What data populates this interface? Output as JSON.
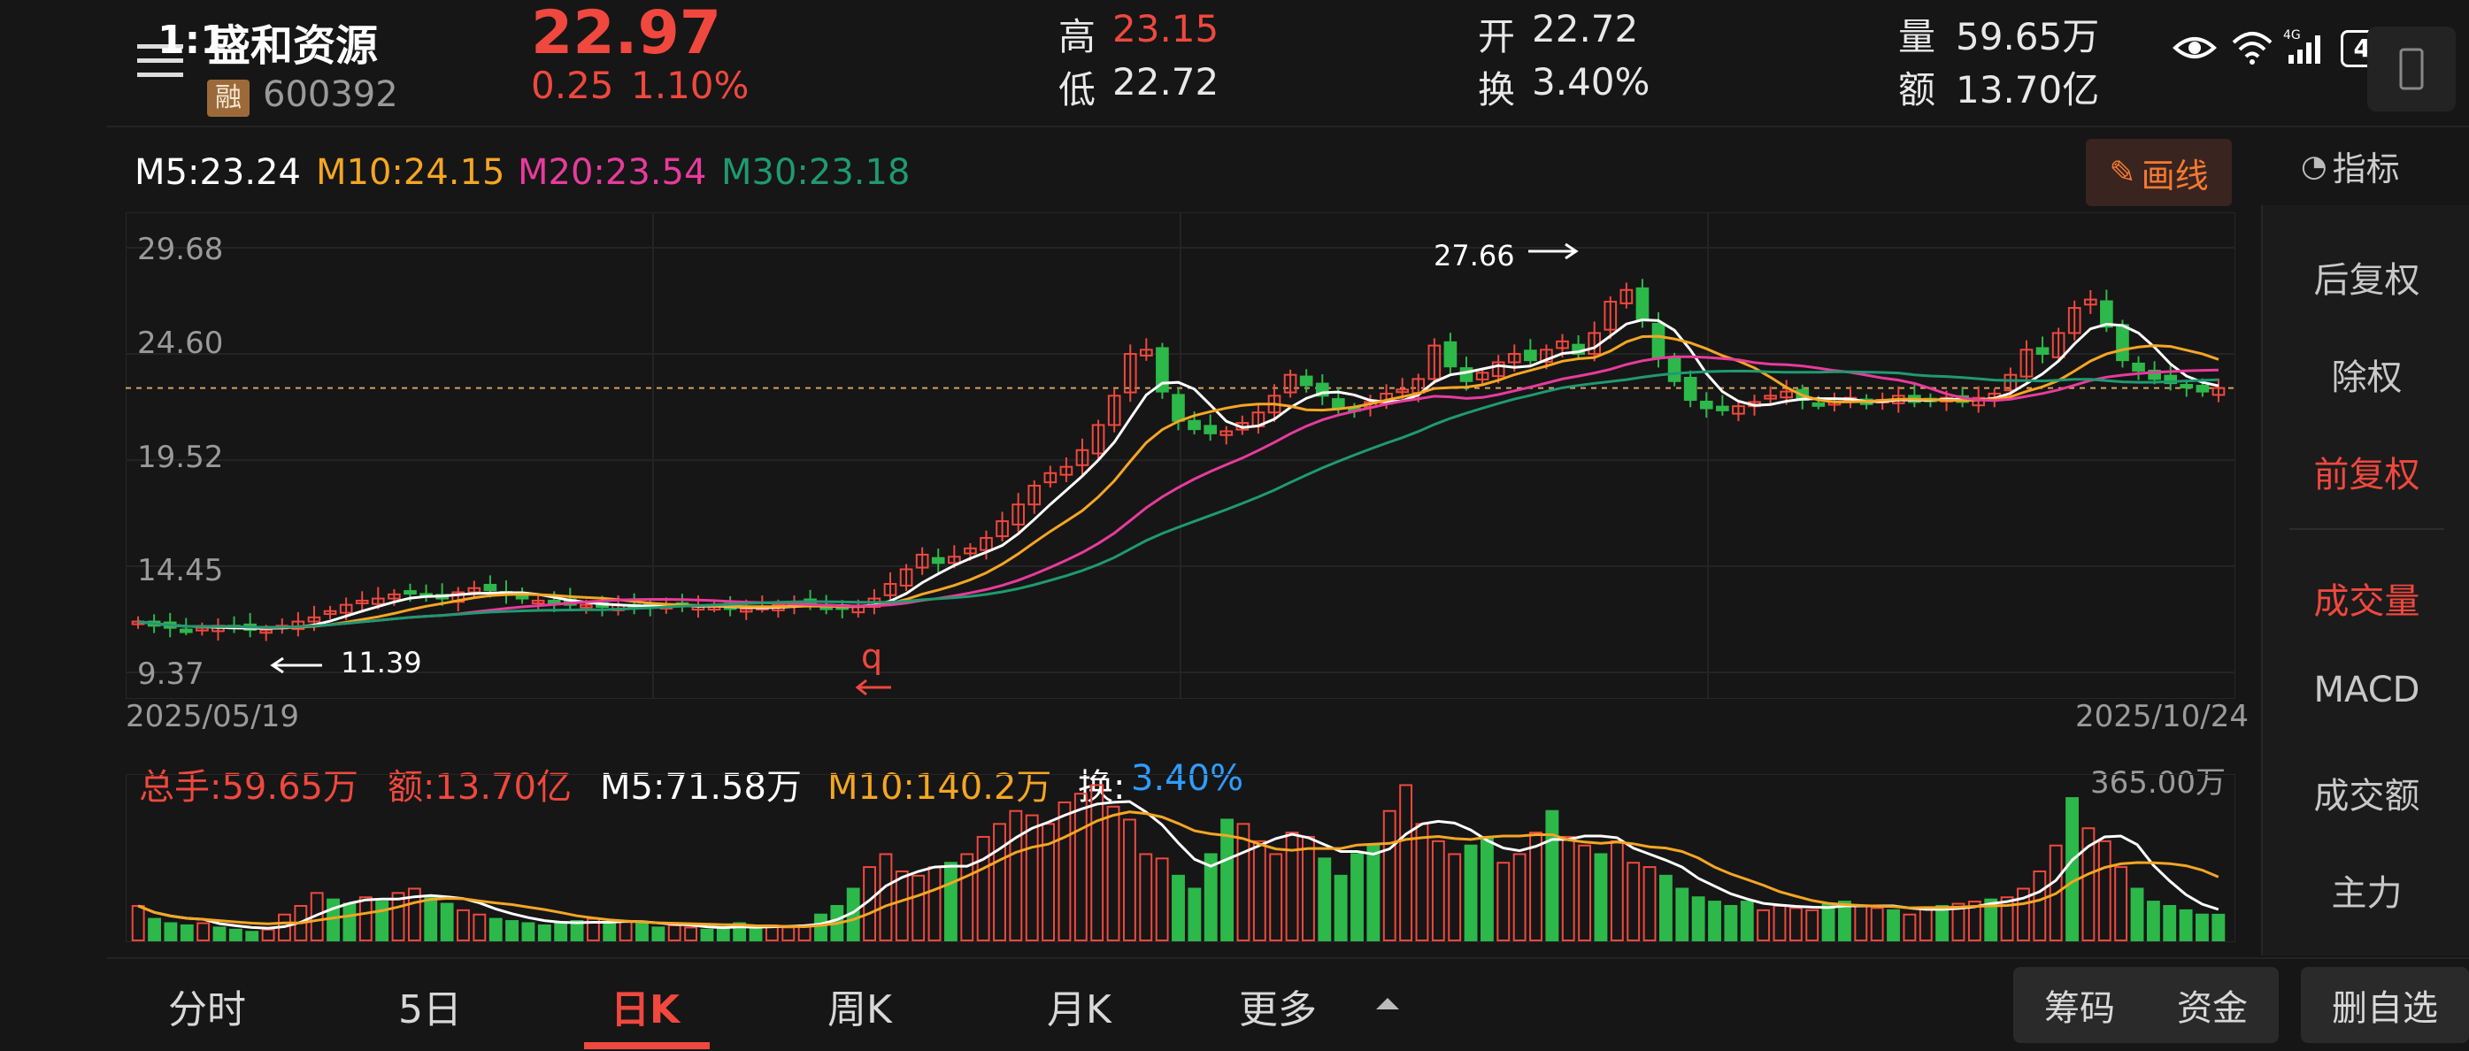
{
  "header": {
    "menu_overlay": "1:1",
    "stock_name": "盛和资源",
    "margin_badge": "融",
    "stock_code": "600392",
    "price": "22.97",
    "change": "0.25",
    "change_pct": "1.10%",
    "high_label": "高",
    "high_value": "23.15",
    "low_label": "低",
    "low_value": "22.72",
    "open_label": "开",
    "open_value": "22.72",
    "turnover_label": "换",
    "turnover_value": "3.40%",
    "volume_label": "量",
    "volume_value": "59.65万",
    "amount_label": "额",
    "amount_value": "13.70亿",
    "battery": "47"
  },
  "ma_legend": {
    "m5": "M5:23.24",
    "m10": "M10:24.15",
    "m20": "M20:23.54",
    "m30": "M30:23.18"
  },
  "draw_button": "画线",
  "indicator_button": "指标",
  "price_axis": [
    "29.68",
    "24.60",
    "19.52",
    "14.45",
    "9.37"
  ],
  "date_start": "2025/05/19",
  "date_end": "2025/10/24",
  "annotations": {
    "high_mark": "27.66",
    "low_mark": "11.39",
    "q_mark": "q"
  },
  "volume_legend": {
    "total": "总手:59.65万",
    "amount": "额:13.70亿",
    "m5": "M5:71.58万",
    "m10": "M10:140.2万",
    "turnover_label": "换:",
    "turnover_value": "3.40%",
    "vol_max": "365.00万"
  },
  "sidebar": {
    "items": [
      "后复权",
      "除权",
      "前复权",
      "成交量",
      "MACD",
      "成交额",
      "主力"
    ]
  },
  "tabs": [
    "分时",
    "5日",
    "日K",
    "周K",
    "月K",
    "更多"
  ],
  "bottom_buttons": [
    "筹码",
    "资金",
    "删自选"
  ],
  "colors": {
    "up": "#f0483e",
    "down": "#2db84a",
    "m5": "#ffffff",
    "m10": "#f5a623",
    "m20": "#e83b9d",
    "m30": "#1f9a70",
    "background": "#161616"
  },
  "chart_data": {
    "type": "candlestick",
    "x_range": [
      "2025/05/19",
      "2025/10/24"
    ],
    "ylim": [
      9.37,
      29.68
    ],
    "y_ticks": [
      29.68,
      24.6,
      19.52,
      14.45,
      9.37
    ],
    "current_price": 22.97,
    "high": 27.66,
    "low": 11.39,
    "closes": [
      11.8,
      11.6,
      11.5,
      11.4,
      11.5,
      11.6,
      11.5,
      11.4,
      11.39,
      11.6,
      11.8,
      12.0,
      12.3,
      12.6,
      12.8,
      12.9,
      13.1,
      13.2,
      13.0,
      12.9,
      13.2,
      13.4,
      13.3,
      13.1,
      12.9,
      12.8,
      12.7,
      12.6,
      12.6,
      12.5,
      12.6,
      12.5,
      12.5,
      12.6,
      12.6,
      12.5,
      12.5,
      12.4,
      12.4,
      12.5,
      12.6,
      12.7,
      12.6,
      12.5,
      12.4,
      12.5,
      12.9,
      13.6,
      14.3,
      15.0,
      14.6,
      14.9,
      15.3,
      15.8,
      16.6,
      17.4,
      18.3,
      18.9,
      19.2,
      20.0,
      21.2,
      22.6,
      24.6,
      24.8,
      22.8,
      21.4,
      21.0,
      20.8,
      20.9,
      21.3,
      21.8,
      22.6,
      23.6,
      23.1,
      22.6,
      22.0,
      21.9,
      22.3,
      22.7,
      22.9,
      23.4,
      25.0,
      24.0,
      23.3,
      23.7,
      24.2,
      24.6,
      24.3,
      24.8,
      25.2,
      24.6,
      25.6,
      27.1,
      27.66,
      26.2,
      24.4,
      23.3,
      22.4,
      22.0,
      21.9,
      22.1,
      22.3,
      22.6,
      22.8,
      22.4,
      22.2,
      22.3,
      22.5,
      22.2,
      22.4,
      22.6,
      22.3,
      22.4,
      22.5,
      22.3,
      22.5,
      22.7,
      23.6,
      24.8,
      24.6,
      25.6,
      26.8,
      27.2,
      25.9,
      24.3,
      23.8,
      23.4,
      23.2,
      23.0,
      22.8,
      22.97
    ],
    "ma_values": {
      "M5": 23.24,
      "M10": 24.15,
      "M20": 23.54,
      "M30": 23.18
    },
    "volume": {
      "unit": "万",
      "max": 365.0,
      "total": 59.65,
      "m5": 71.58,
      "m10": 140.2,
      "values": [
        80,
        50,
        40,
        35,
        40,
        30,
        25,
        20,
        25,
        60,
        80,
        110,
        95,
        85,
        100,
        90,
        110,
        120,
        100,
        85,
        70,
        60,
        50,
        45,
        40,
        35,
        40,
        45,
        50,
        40,
        45,
        38,
        30,
        35,
        30,
        25,
        28,
        40,
        30,
        35,
        30,
        35,
        60,
        80,
        120,
        170,
        200,
        160,
        150,
        170,
        180,
        200,
        240,
        270,
        300,
        290,
        270,
        320,
        340,
        360,
        310,
        280,
        200,
        190,
        150,
        120,
        200,
        280,
        270,
        230,
        200,
        250,
        240,
        190,
        150,
        200,
        220,
        300,
        360,
        270,
        230,
        200,
        220,
        240,
        180,
        200,
        250,
        300,
        240,
        220,
        200,
        230,
        180,
        170,
        150,
        120,
        100,
        90,
        80,
        90,
        70,
        80,
        75,
        70,
        85,
        90,
        80,
        75,
        70,
        60,
        75,
        80,
        85,
        90,
        95,
        100,
        120,
        160,
        220,
        330,
        260,
        230,
        170,
        120,
        90,
        80,
        70,
        60,
        59.65
      ],
      "up": [
        true,
        false,
        false,
        false,
        true,
        false,
        false,
        false,
        true,
        true,
        true,
        true,
        false,
        false,
        true,
        false,
        true,
        true,
        false,
        false,
        true,
        true,
        false,
        false,
        false,
        false,
        false,
        false,
        true,
        false,
        true,
        false,
        false,
        true,
        true,
        false,
        false,
        false,
        false,
        true,
        true,
        true,
        false,
        false,
        false,
        true,
        true,
        true,
        true,
        true,
        false,
        true,
        true,
        true,
        true,
        true,
        true,
        true,
        true,
        true,
        true,
        true,
        true,
        true,
        false,
        false,
        false,
        false,
        true,
        true,
        true,
        true,
        true,
        false,
        false,
        false,
        false,
        true,
        true,
        true,
        true,
        true,
        false,
        false,
        true,
        true,
        true,
        false,
        true,
        true,
        false,
        true,
        true,
        true,
        false,
        false,
        false,
        false,
        false,
        false,
        true,
        true,
        true,
        true,
        false,
        false,
        true,
        true,
        false,
        true,
        true,
        false,
        true,
        true,
        false,
        true,
        true,
        true,
        true,
        false,
        true,
        true,
        true,
        false,
        false,
        false,
        false,
        false,
        false,
        false,
        true
      ]
    }
  }
}
